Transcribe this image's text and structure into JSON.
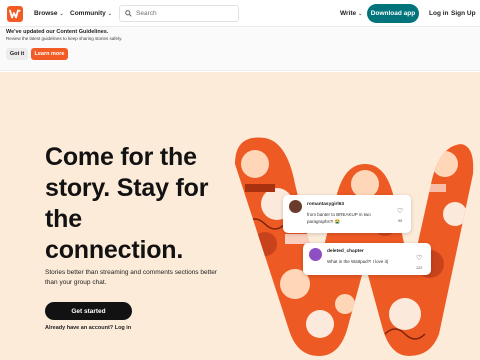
{
  "nav": {
    "browse": "Browse",
    "community": "Community",
    "search_placeholder": "Search",
    "write": "Write",
    "download": "Download app",
    "login": "Log in",
    "signup": "Sign Up"
  },
  "notice": {
    "title": "We've updated our Content Guidelines.",
    "text": "Review the latest guidelines to keep sharing stories safely.",
    "got_it": "Got it",
    "learn_more": "Learn more"
  },
  "hero": {
    "headline_line1": "Come for the",
    "headline_line2": "story. Stay for",
    "headline_line3": "the",
    "headline_line4": "connection.",
    "subtext": "Stories better than streaming and comments sections better than your group chat.",
    "cta": "Get started",
    "have_account": "Already have an account?",
    "login_link": "Log in"
  },
  "comments": [
    {
      "user": "romantasygirl63",
      "text": "from banter to BREAKUP in two paragraphs?! 😭",
      "likes": "95"
    },
    {
      "user": "deleted_chapter",
      "text": "What in the Wattpad?! I love it)",
      "likes": "122"
    }
  ],
  "colors": {
    "brand_orange": "#f35b24",
    "teal": "#00747a",
    "hero_bg": "#fdebd9"
  }
}
